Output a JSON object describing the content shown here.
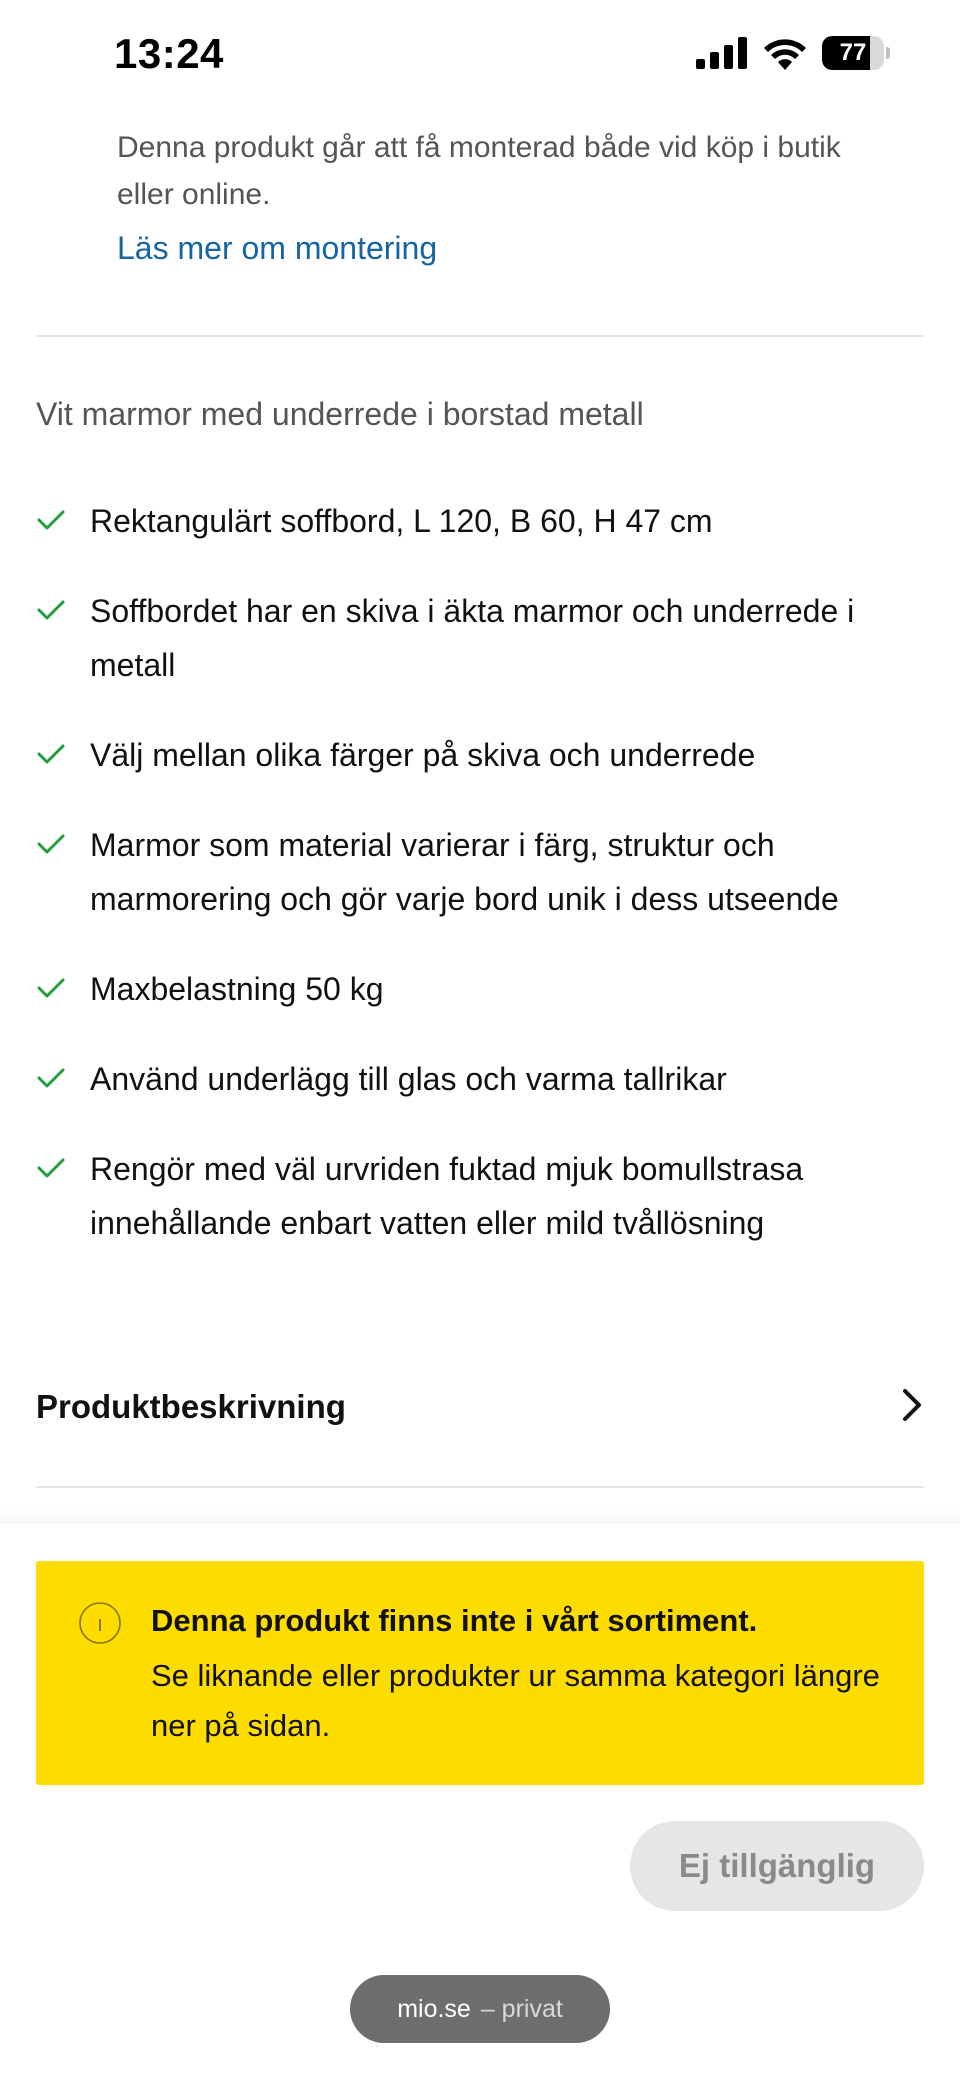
{
  "status_bar": {
    "time": "13:24",
    "battery_level": "77",
    "battery_fraction": 0.77
  },
  "montering": {
    "text": "Denna produkt går att få monterad både vid köp i butik eller online.",
    "link": "Läs mer om montering"
  },
  "product": {
    "subtitle": "Vit marmor med underrede i borstad metall",
    "features": [
      "Rektangulärt soffbord, L 120, B 60, H 47 cm",
      "Soffbordet har en skiva i äkta marmor och underrede i metall",
      "Välj mellan olika färger på skiva och underrede",
      "Marmor som material varierar i färg, struktur och marmorering och gör varje bord unik i dess utseende",
      "Maxbelastning 50 kg",
      "Använd underlägg till glas och varma tallrikar",
      "Rengör med väl urvriden fuktad mjuk bomullstrasa innehållande enbart vatten eller mild tvållösning"
    ],
    "accordion_title": "Produktbeskrivning"
  },
  "notice": {
    "title": "Denna produkt finns inte i vårt sortiment.",
    "body": "Se liknande eller produkter ur samma kategori längre ner på sidan."
  },
  "actions": {
    "unavailable_label": "Ej tillgänglig"
  },
  "browser": {
    "domain": "mio.se",
    "mode": "– privat"
  },
  "colors": {
    "check": "#1f9d3a",
    "link": "#1565a3",
    "notice_bg": "#fddc00",
    "button_bg": "#e6e6e6"
  },
  "icons": {
    "check": "check-icon",
    "chevron": "chevron-right-icon",
    "info": "info-icon"
  }
}
